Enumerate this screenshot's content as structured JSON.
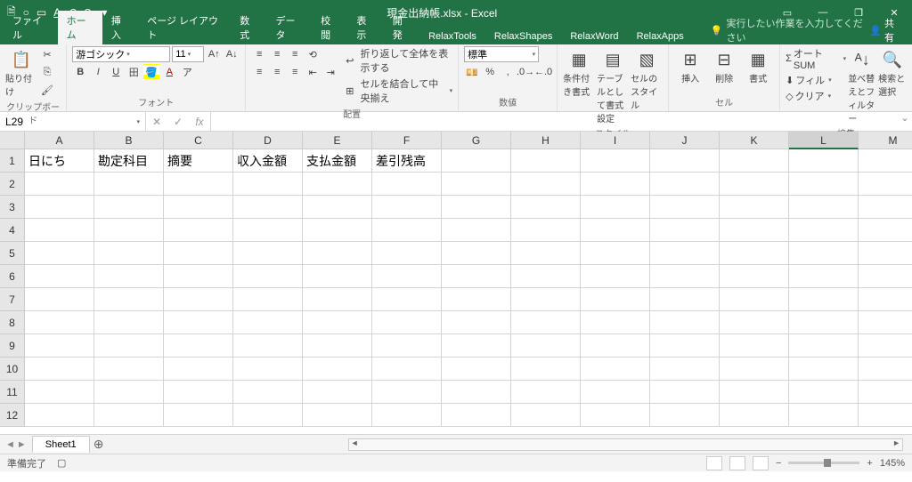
{
  "titlebar": {
    "filename": "現金出納帳.xlsx - Excel"
  },
  "tabs": {
    "file": "ファイル",
    "home": "ホーム",
    "insert": "挿入",
    "pagelayout": "ページ レイアウト",
    "formulas": "数式",
    "data": "データ",
    "review": "校閲",
    "view": "表示",
    "developer": "開発",
    "relaxtools": "RelaxTools",
    "relaxshapes": "RelaxShapes",
    "relaxword": "RelaxWord",
    "relaxapps": "RelaxApps",
    "tellme": "実行したい作業を入力してください",
    "share": "共有"
  },
  "ribbon": {
    "clipboard": {
      "paste": "貼り付け",
      "label": "クリップボード"
    },
    "font": {
      "name": "游ゴシック",
      "size": "11",
      "label": "フォント"
    },
    "align": {
      "wrap": "折り返して全体を表示する",
      "merge": "セルを結合して中央揃え",
      "label": "配置"
    },
    "number": {
      "format": "標準",
      "label": "数値"
    },
    "styles": {
      "cond": "条件付き書式",
      "table": "テーブルとして書式設定",
      "cellstyle": "セルのスタイル",
      "label": "スタイル"
    },
    "cells": {
      "insert": "挿入",
      "delete": "削除",
      "format": "書式",
      "label": "セル"
    },
    "editing": {
      "autosum": "オート SUM",
      "fill": "フィル",
      "clear": "クリア",
      "sort": "並べ替えとフィルター",
      "find": "検索と選択",
      "label": "編集"
    }
  },
  "namebox": "L29",
  "columns": [
    "A",
    "B",
    "C",
    "D",
    "E",
    "F",
    "G",
    "H",
    "I",
    "J",
    "K",
    "L",
    "M"
  ],
  "selectedCol": "L",
  "rows": [
    "1",
    "2",
    "3",
    "4",
    "5",
    "6",
    "7",
    "8",
    "9",
    "10",
    "11",
    "12"
  ],
  "cellsRow1": [
    "日にち",
    "勘定科目",
    "摘要",
    "収入金額",
    "支払金額",
    "差引残高",
    "",
    "",
    "",
    "",
    "",
    "",
    ""
  ],
  "sheet": {
    "name": "Sheet1"
  },
  "status": {
    "ready": "準備完了",
    "zoom": "145%"
  }
}
